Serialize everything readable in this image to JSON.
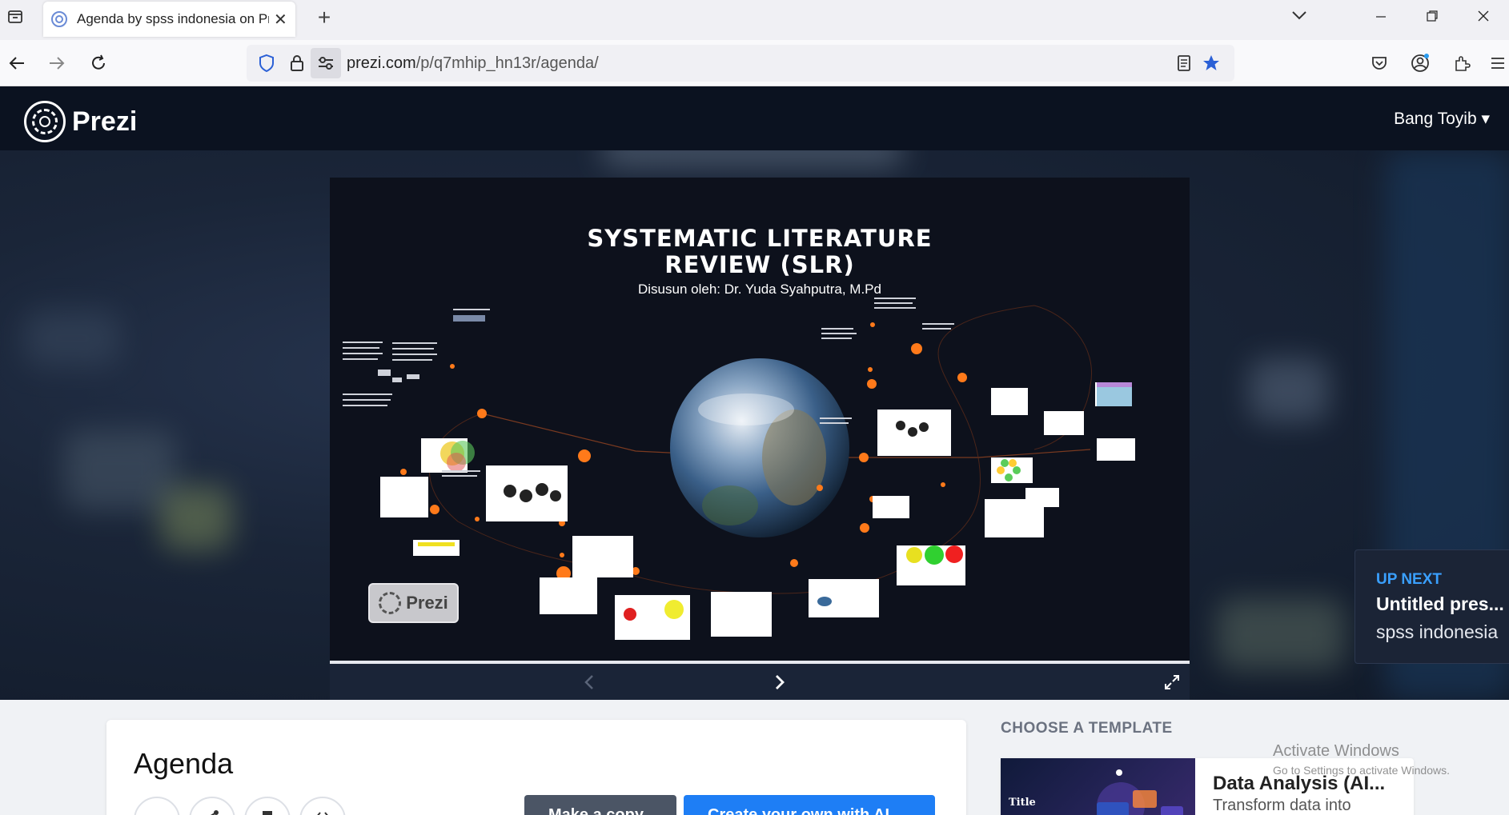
{
  "browser": {
    "tab_title": "Agenda by spss indonesia on Prezi",
    "url_host": "prezi.com",
    "url_path": "/p/q7mhip_hn13r/agenda/"
  },
  "header": {
    "brand": "Prezi",
    "user_name": "Bang Toyib ▾"
  },
  "slide": {
    "title_line1": "SYSTEMATIC LITERATURE",
    "title_line2": "REVIEW (SLR)",
    "subtitle": "Disusun oleh: Dr. Yuda Syahputra, M.Pd",
    "badge": "Prezi",
    "accent": "#ff7a1a"
  },
  "up_next": {
    "label": "UP NEXT",
    "title": "Untitled pres...",
    "author": "spss indonesia"
  },
  "presentation": {
    "title": "Agenda",
    "make_copy": "Make a copy",
    "create_ai": "Create your own with AI"
  },
  "templates": {
    "heading": "CHOOSE A TEMPLATE",
    "thumb_title": "Title",
    "name": "Data Analysis (AI...",
    "description": "Transform data into"
  },
  "watermark": {
    "line1": "Activate Windows",
    "line2": "Go to Settings to activate Windows."
  }
}
